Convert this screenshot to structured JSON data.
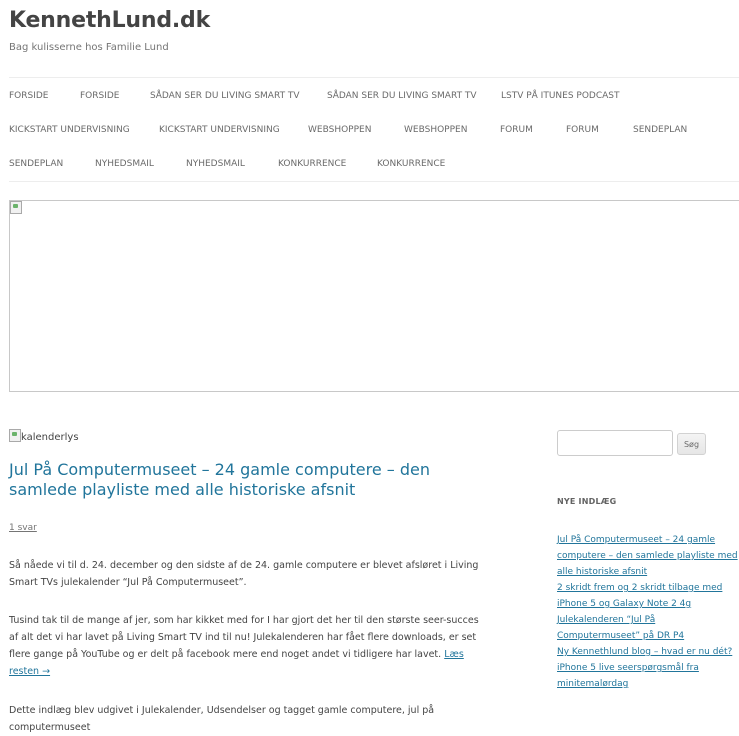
{
  "site": {
    "title": "KennethLund.dk",
    "description": "Bag kulisserne hos Familie Lund"
  },
  "nav": {
    "row1": [
      "FORSIDE",
      "FORSIDE",
      "SÅDAN SER DU LIVING SMART TV",
      "SÅDAN SER DU LIVING SMART TV",
      "LSTV PÅ ITUNES PODCAST"
    ],
    "row2": [
      "KICKSTART UNDERVISNING",
      "KICKSTART UNDERVISNING",
      "WEBSHOPPEN",
      "WEBSHOPPEN",
      "FORUM",
      "FORUM",
      "SENDEPLAN"
    ],
    "row3": [
      "SENDEPLAN",
      "NYHEDSMAIL",
      "NYHEDSMAIL",
      "KONKURRENCE",
      "KONKURRENCE"
    ]
  },
  "post": {
    "thumb_alt": "kalenderlys",
    "title": "Jul På Computermuseet – 24 gamle computere – den samlede playliste med alle historiske afsnit",
    "comments": "1 svar",
    "para1": "Så nåede vi til d. 24. december og den sidste af de 24. gamle computere er blevet afsløret i Living Smart TVs julekalender “Jul På Computermuseet”.",
    "para2": "Tusind tak til de mange af jer, som har kikket med for I har gjort det her til den største seer-succes af alt det vi har lavet på Living Smart TV ind til nu! Julekalenderen har fået flere downloads, er set flere gange på YouTube og er delt på facebook mere end noget andet vi tidligere har lavet.",
    "read_more": "Læs resten →",
    "para3": "Dette indlæg blev udgivet i Julekalender, Udsendelser og tagget gamle computere, jul på computermuseet"
  },
  "sidebar": {
    "search_button": "Søg",
    "search_value": "",
    "recent_title": "NYE INDLÆG",
    "recent": [
      "Jul På Computermuseet – 24 gamle computere – den samlede playliste med alle historiske afsnit",
      "2 skridt frem og 2 skridt tilbage med iPhone 5 og Galaxy Note 2 4g",
      "Julekalenderen “Jul På Computermuseet” på DR P4",
      "Ny Kennethlund blog – hvad er nu dét?",
      "iPhone 5 live seerspørgsmål fra minitemalørdag"
    ]
  }
}
